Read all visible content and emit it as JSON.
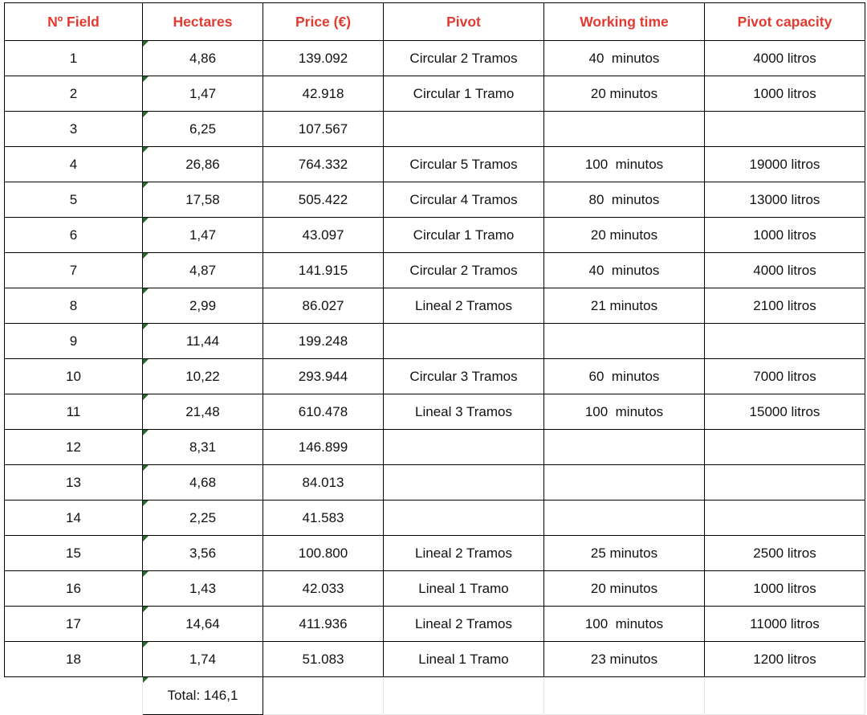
{
  "table": {
    "headers": [
      "Nº Field",
      "Hectares",
      "Price (€)",
      "Pivot",
      "Working time",
      "Pivot capacity"
    ],
    "rows": [
      {
        "field": "1",
        "hectares": "4,86",
        "price": "139.092",
        "pivot": "Circular 2 Tramos",
        "working_time": "40  minutos",
        "capacity": "4000 litros",
        "struck": false
      },
      {
        "field": "2",
        "hectares": "1,47",
        "price": "42.918",
        "pivot": "Circular 1 Tramo",
        "working_time": "20 minutos",
        "capacity": "1000 litros",
        "struck": false
      },
      {
        "field": "3",
        "hectares": "6,25",
        "price": "107.567",
        "pivot": "",
        "working_time": "",
        "capacity": "",
        "struck": true
      },
      {
        "field": "4",
        "hectares": "26,86",
        "price": "764.332",
        "pivot": "Circular 5 Tramos",
        "working_time": "100  minutos",
        "capacity": "19000 litros",
        "struck": false
      },
      {
        "field": "5",
        "hectares": "17,58",
        "price": "505.422",
        "pivot": "Circular 4 Tramos",
        "working_time": "80  minutos",
        "capacity": "13000 litros",
        "struck": false
      },
      {
        "field": "6",
        "hectares": "1,47",
        "price": "43.097",
        "pivot": "Circular 1 Tramo",
        "working_time": "20 minutos",
        "capacity": "1000 litros",
        "struck": false
      },
      {
        "field": "7",
        "hectares": "4,87",
        "price": "141.915",
        "pivot": "Circular 2 Tramos",
        "working_time": "40  minutos",
        "capacity": "4000 litros",
        "struck": false
      },
      {
        "field": "8",
        "hectares": "2,99",
        "price": "86.027",
        "pivot": "Lineal 2 Tramos",
        "working_time": "21 minutos",
        "capacity": "2100 litros",
        "struck": false
      },
      {
        "field": "9",
        "hectares": "11,44",
        "price": "199.248",
        "pivot": "",
        "working_time": "",
        "capacity": "",
        "struck": true
      },
      {
        "field": "10",
        "hectares": "10,22",
        "price": "293.944",
        "pivot": "Circular 3 Tramos",
        "working_time": "60  minutos",
        "capacity": "7000 litros",
        "struck": false
      },
      {
        "field": "11",
        "hectares": "21,48",
        "price": "610.478",
        "pivot": "Lineal 3 Tramos",
        "working_time": "100  minutos",
        "capacity": "15000 litros",
        "struck": false
      },
      {
        "field": "12",
        "hectares": "8,31",
        "price": "146.899",
        "pivot": "",
        "working_time": "",
        "capacity": "",
        "struck": true
      },
      {
        "field": "13",
        "hectares": "4,68",
        "price": "84.013",
        "pivot": "",
        "working_time": "",
        "capacity": "",
        "struck": true
      },
      {
        "field": "14",
        "hectares": "2,25",
        "price": "41.583",
        "pivot": "",
        "working_time": "",
        "capacity": "",
        "struck": true
      },
      {
        "field": "15",
        "hectares": "3,56",
        "price": "100.800",
        "pivot": "Lineal 2 Tramos",
        "working_time": "25 minutos",
        "capacity": "2500 litros",
        "struck": false
      },
      {
        "field": "16",
        "hectares": "1,43",
        "price": "42.033",
        "pivot": "Lineal 1 Tramo",
        "working_time": "20 minutos",
        "capacity": "1000 litros",
        "struck": false
      },
      {
        "field": "17",
        "hectares": "14,64",
        "price": "411.936",
        "pivot": "Lineal 2 Tramos",
        "working_time": "100  minutos",
        "capacity": "11000 litros",
        "struck": false
      },
      {
        "field": "18",
        "hectares": "1,74",
        "price": "51.083",
        "pivot": "Lineal 1 Tramo",
        "working_time": "23 minutos",
        "capacity": "1200 litros",
        "struck": false
      }
    ],
    "total_row": {
      "field": "",
      "hectares": "Total: 146,1",
      "price": "",
      "pivot": "",
      "working_time": "",
      "capacity": ""
    },
    "colors": {
      "header_text": "#e23a30",
      "body_text": "#111111",
      "strike": "#cc1111",
      "border": "#000000",
      "gridline": "#e6e6e6",
      "comment_marker": "#1f6b2a"
    }
  }
}
